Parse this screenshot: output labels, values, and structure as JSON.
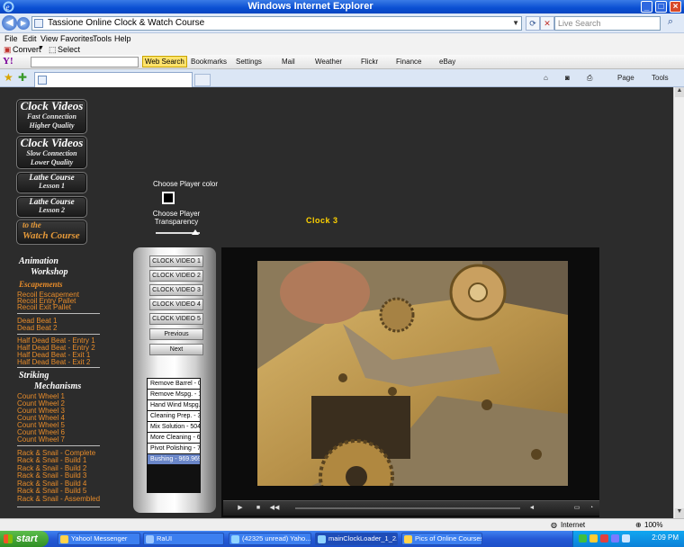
{
  "window": {
    "title": "Windows Internet Explorer"
  },
  "address": {
    "url": "Tassione Online Clock & Watch Course",
    "search_placeholder": "Live Search"
  },
  "menubar": [
    "File",
    "Edit",
    "View",
    "Favorites",
    "Tools",
    "Help"
  ],
  "convert": {
    "convert_label": "Convert",
    "select_label": "Select"
  },
  "yahoo": {
    "web_search_label": "Web Search",
    "items": [
      "Bookmarks",
      "Settings",
      "Mail",
      "Weather",
      "Flickr",
      "Finance",
      "eBay"
    ]
  },
  "tabbar": {
    "page_label": "Page",
    "tools_label": "Tools"
  },
  "left_nav": {
    "buttons": [
      {
        "title": "Clock Videos",
        "sub1": "Fast Connection",
        "sub2": "Higher Quality"
      },
      {
        "title": "Clock Videos",
        "sub1": "Slow Connection",
        "sub2": "Lower Quality"
      },
      {
        "title": "Lathe Course",
        "sub1": "Lesson 1"
      },
      {
        "title": "Lathe Course",
        "sub1": "Lesson 2"
      },
      {
        "title": "Watch Course",
        "sub1": "to the"
      }
    ],
    "animation": {
      "title1": "Animation",
      "title2": "Workshop",
      "escapements": "Escapements"
    },
    "escapement_links": [
      "Recoil Escapement",
      "Recoil Entry Pallet",
      "Recoil Exit Pallet"
    ],
    "deadbeat_links": [
      "Dead Beat 1",
      "Dead Beat 2"
    ],
    "halfdead_links": [
      "Half Dead Beat - Entry 1",
      "Half Dead Beat - Entry 2",
      "Half Dead Beat - Exit 1",
      "Half Dead Beat - Exit 2"
    ],
    "striking": {
      "title1": "Striking",
      "title2": "Mechanisms"
    },
    "countwheel_links": [
      "Count Wheel 1",
      "Count Wheel 2",
      "Count Wheel 3",
      "Count Wheel 4",
      "Count Wheel 5",
      "Count Wheel 6",
      "Count Wheel 7"
    ],
    "rack_links": [
      "Rack & Snail - Complete",
      "Rack & Snail - Build 1",
      "Rack & Snail - Build 2",
      "Rack & Snail - Build 3",
      "Rack & Snail - Build 4",
      "Rack & Snail - Build 5",
      "Rack & Snail - Assembled"
    ]
  },
  "player": {
    "choose_color": "Choose Player color",
    "choose_transparency_1": "Choose Player",
    "choose_transparency_2": "Transparency",
    "transparency_level": 0.9,
    "now_playing": "Clock 3",
    "video_buttons": [
      "CLOCK VIDEO 1",
      "CLOCK VIDEO 2",
      "CLOCK VIDEO 3",
      "CLOCK VIDEO 4",
      "CLOCK VIDEO 5"
    ],
    "previous_label": "Previous",
    "next_label": "Next",
    "chapters": [
      "Remove Barrel - 0",
      "Remove Mspg. - 1",
      "Hand Wind Mspg.",
      "Cleaning Prep. - 3",
      "Mix Solution - 504",
      "More Cleaning - 6",
      "Pivot Polishing - 7",
      "Bushing - 969.969"
    ],
    "selected_chapter": 7
  },
  "status": {
    "zone": "Internet",
    "zoom": "100%"
  },
  "taskbar": {
    "start_label": "start",
    "tasks": [
      "Yahoo! Messenger",
      "RaUI",
      "(42325 unread) Yaho...",
      "mainClockLoader_1_2...",
      "Pics of Online Courses"
    ],
    "clock": "2:09 PM"
  },
  "colors": {
    "accent_orange": "#e88c2a",
    "clock_label": "#ffd200",
    "xp_blue": "#0a4fd2"
  }
}
